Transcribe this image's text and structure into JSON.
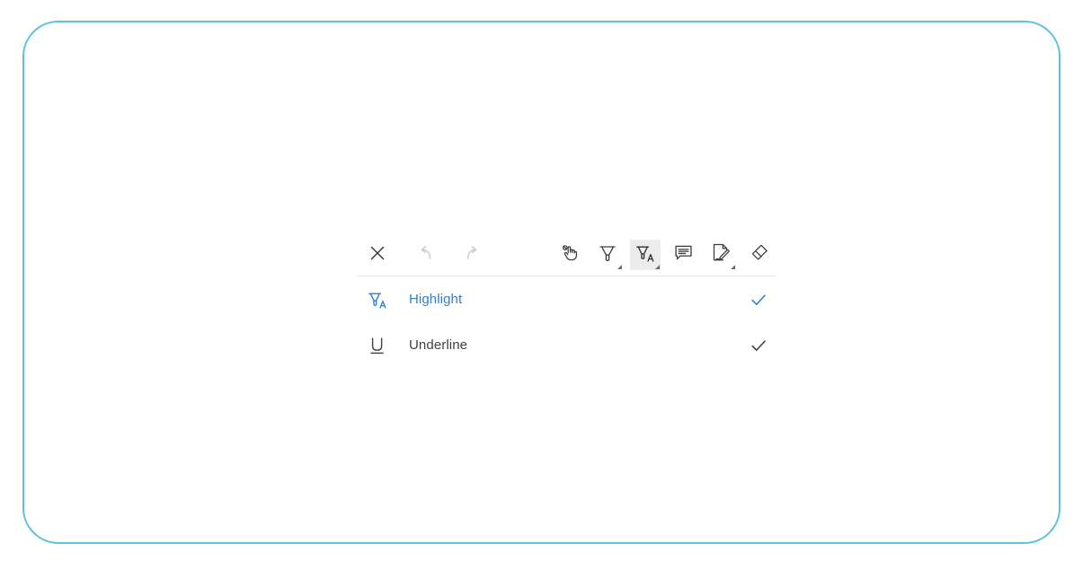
{
  "frame": {
    "border_color": "#5bc2dd",
    "background": "#ffffff"
  },
  "panel": {
    "background": "#ffffff",
    "separator_color": "#e8e8e8"
  },
  "toolbar": {
    "left_tools": [
      {
        "name": "close",
        "icon": "close-icon",
        "label": "Close",
        "state": "enabled"
      },
      {
        "name": "undo",
        "icon": "undo-icon",
        "label": "Undo",
        "state": "disabled"
      },
      {
        "name": "redo",
        "icon": "redo-icon",
        "label": "Redo",
        "state": "disabled"
      }
    ],
    "right_tools": [
      {
        "name": "touch-select",
        "icon": "hand-touch-icon",
        "label": "Touch Select",
        "state": "enabled",
        "has_dropdown": false
      },
      {
        "name": "marker",
        "icon": "marker-pen-icon",
        "label": "Marker",
        "state": "enabled",
        "has_dropdown": true
      },
      {
        "name": "text-markup",
        "icon": "highlight-a-icon",
        "label": "Text Markup",
        "state": "selected",
        "has_dropdown": true
      },
      {
        "name": "comment",
        "icon": "comment-icon",
        "label": "Comment",
        "state": "enabled",
        "has_dropdown": false
      },
      {
        "name": "note",
        "icon": "note-edit-icon",
        "label": "Note",
        "state": "enabled",
        "has_dropdown": true
      },
      {
        "name": "eraser",
        "icon": "eraser-icon",
        "label": "Eraser",
        "state": "enabled",
        "has_dropdown": false
      }
    ]
  },
  "menu": {
    "items": [
      {
        "id": "highlight",
        "label": "Highlight",
        "icon": "highlight-a-icon",
        "selected": true,
        "check_icon": "check-icon",
        "text_color": "#2b7fd4",
        "icon_color": "#2b7fd4",
        "check_color": "#2b7fd4"
      },
      {
        "id": "underline",
        "label": "Underline",
        "icon": "underline-u-icon",
        "selected": false,
        "check_icon": "check-icon",
        "text_color": "#3f3f3f",
        "icon_color": "#3f3f3f",
        "check_color": "#3f3f3f"
      }
    ]
  }
}
